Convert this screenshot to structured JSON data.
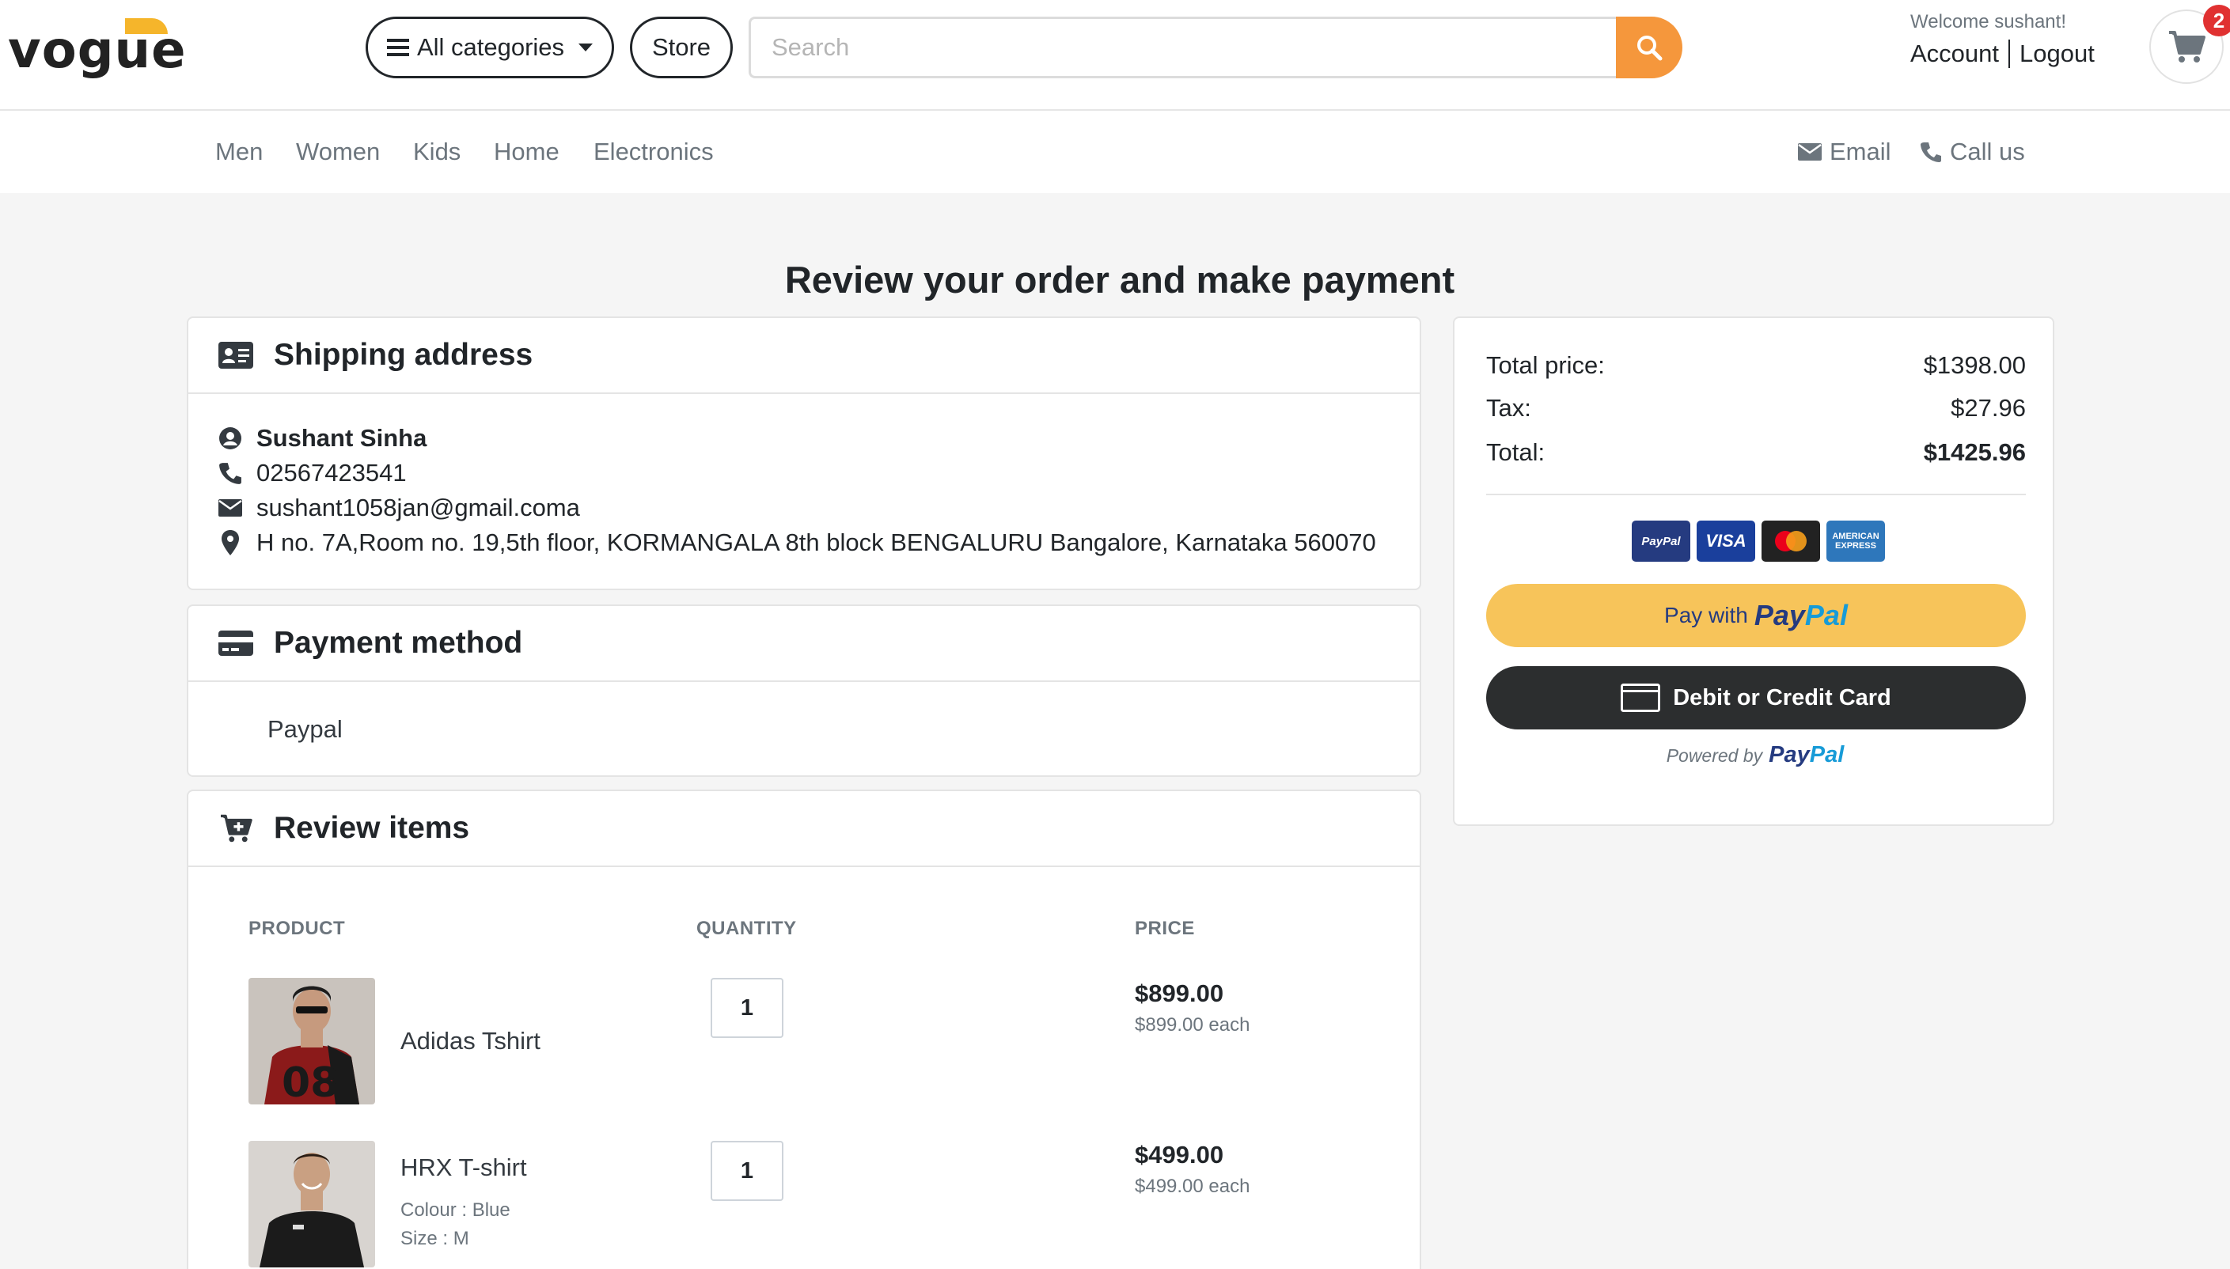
{
  "header": {
    "logo_text": "vogue",
    "categories_label": "All categories",
    "store_label": "Store",
    "search_placeholder": "Search",
    "welcome": "Welcome sushant!",
    "account_label": "Account",
    "logout_label": "Logout",
    "cart_count": "2"
  },
  "subnav": {
    "links": [
      "Men",
      "Women",
      "Kids",
      "Home",
      "Electronics"
    ],
    "email_label": "Email",
    "call_label": "Call us"
  },
  "page_title": "Review your order and make payment",
  "shipping": {
    "title": "Shipping address",
    "name": "Sushant Sinha",
    "phone": "02567423541",
    "email": "sushant1058jan@gmail.coma",
    "address": "H no. 7A,Room no. 19,5th floor, KORMANGALA 8th block BENGALURU Bangalore, Karnataka 560070"
  },
  "payment": {
    "title": "Payment method",
    "method": "Paypal"
  },
  "review": {
    "title": "Review items",
    "headers": [
      "PRODUCT",
      "QUANTITY",
      "PRICE"
    ],
    "items": [
      {
        "name": "Adidas Tshirt",
        "qty": "1",
        "price": "$899.00",
        "each": "$899.00 each"
      },
      {
        "name": "HRX T-shirt",
        "colour": "Colour : Blue",
        "size": "Size : M",
        "qty": "1",
        "price": "$499.00",
        "each": "$499.00 each"
      }
    ]
  },
  "summary": {
    "total_price_label": "Total price:",
    "total_price": "$1398.00",
    "tax_label": "Tax:",
    "tax": "$27.96",
    "total_label": "Total:",
    "total": "$1425.96",
    "card_logos": [
      "PayPal",
      "VISA",
      "mastercard-icon",
      "AMERICAN EXPRESS"
    ],
    "pay_with": "Pay with",
    "paypal_pay": "Pay",
    "paypal_pal": "Pal",
    "debit_label": "Debit or Credit Card",
    "powered_by": "Powered by"
  },
  "colors": {
    "accent_orange": "#f5973c",
    "logo_yellow": "#f5b52b",
    "paypal_yellow": "#f7c45a",
    "paypal_dark": "#2c2e2f",
    "badge_red": "#e03131"
  }
}
